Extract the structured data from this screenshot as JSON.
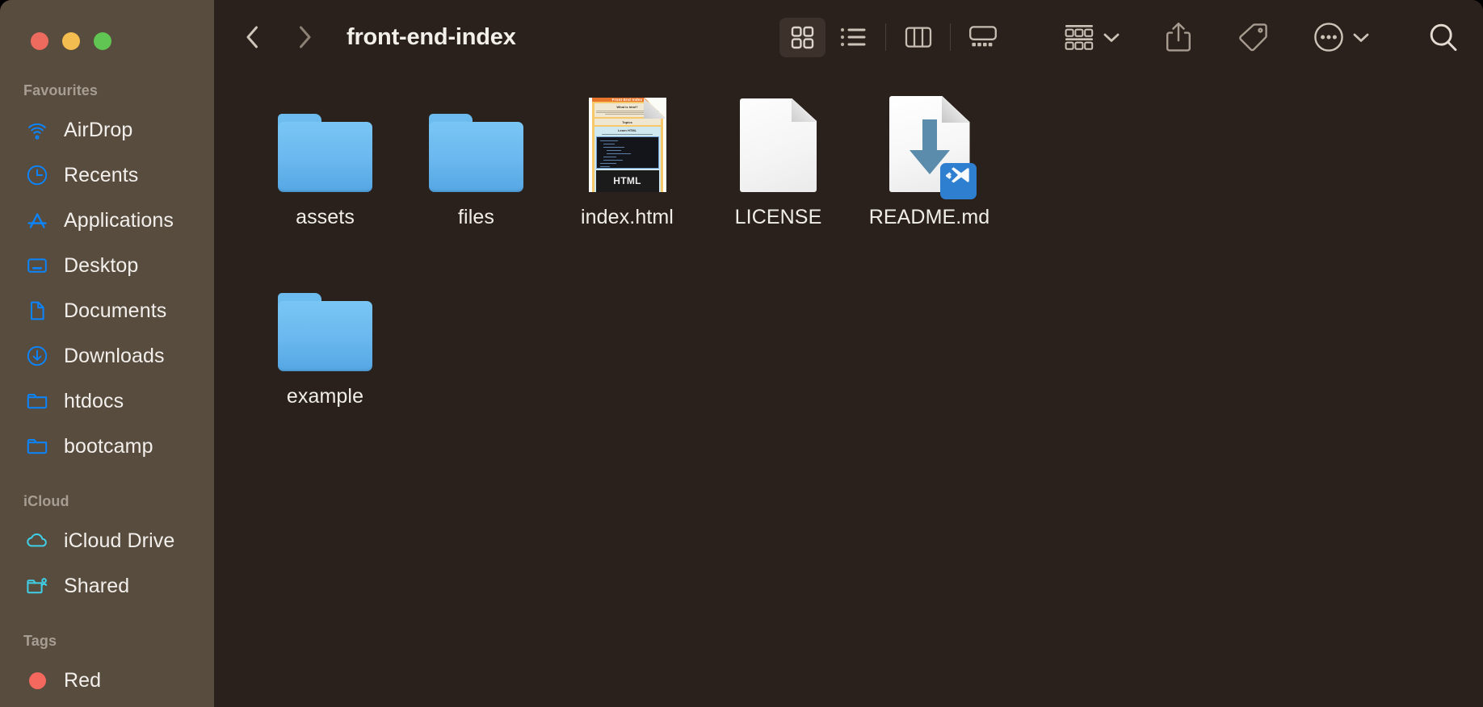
{
  "window": {
    "traffic_lights": [
      {
        "name": "close",
        "color": "#ed6a5e"
      },
      {
        "name": "minimize",
        "color": "#f4bd4f"
      },
      {
        "name": "maximize",
        "color": "#61c554"
      }
    ],
    "background": "#2a211c",
    "sidebar_background": "#584c3e"
  },
  "toolbar": {
    "back_label": "Back",
    "forward_label": "Forward",
    "title": "front-end-index",
    "view_buttons": [
      {
        "id": "icon",
        "label": "Icon View",
        "icon": "grid-icon",
        "active": true
      },
      {
        "id": "list",
        "label": "List View",
        "icon": "list-icon",
        "active": false
      },
      {
        "id": "column",
        "label": "Column View",
        "icon": "columns-icon",
        "active": false
      },
      {
        "id": "gallery",
        "label": "Gallery View",
        "icon": "gallery-icon",
        "active": false
      }
    ],
    "group_label": "Group",
    "share_label": "Share",
    "tags_label": "Tags",
    "more_label": "More",
    "search_label": "Search",
    "accent": "#cdc3b8"
  },
  "sidebar": {
    "sections": [
      {
        "title": "Favourites",
        "items": [
          {
            "label": "AirDrop",
            "icon": "airdrop-icon",
            "color": "#0a84ff"
          },
          {
            "label": "Recents",
            "icon": "clock-icon",
            "color": "#0a84ff"
          },
          {
            "label": "Applications",
            "icon": "applications-icon",
            "color": "#0a84ff"
          },
          {
            "label": "Desktop",
            "icon": "desktop-icon",
            "color": "#0a84ff"
          },
          {
            "label": "Documents",
            "icon": "document-icon",
            "color": "#0a84ff"
          },
          {
            "label": "Downloads",
            "icon": "download-icon",
            "color": "#0a84ff"
          },
          {
            "label": "htdocs",
            "icon": "folder-icon",
            "color": "#0a84ff"
          },
          {
            "label": "bootcamp",
            "icon": "folder-icon",
            "color": "#0a84ff"
          }
        ]
      },
      {
        "title": "iCloud",
        "items": [
          {
            "label": "iCloud Drive",
            "icon": "cloud-icon",
            "color": "#3fd0e8"
          },
          {
            "label": "Shared",
            "icon": "shared-folder-icon",
            "color": "#3fd0e8"
          }
        ]
      },
      {
        "title": "Tags",
        "items": [
          {
            "label": "Red",
            "icon": "tag-dot-icon",
            "color": "#f4685e"
          }
        ]
      }
    ]
  },
  "content": {
    "items": [
      {
        "name": "assets",
        "kind": "folder"
      },
      {
        "name": "files",
        "kind": "folder"
      },
      {
        "name": "index.html",
        "kind": "webpage-thumbnail"
      },
      {
        "name": "LICENSE",
        "kind": "plain-document"
      },
      {
        "name": "README.md",
        "kind": "markdown-document"
      },
      {
        "name": "example",
        "kind": "folder"
      }
    ],
    "thumbnail_text": {
      "header": "Front-End Index",
      "section_title": "What is html?",
      "topics_title": "Topics",
      "subtitle": "Learn HTML",
      "logo": "HTML"
    }
  }
}
